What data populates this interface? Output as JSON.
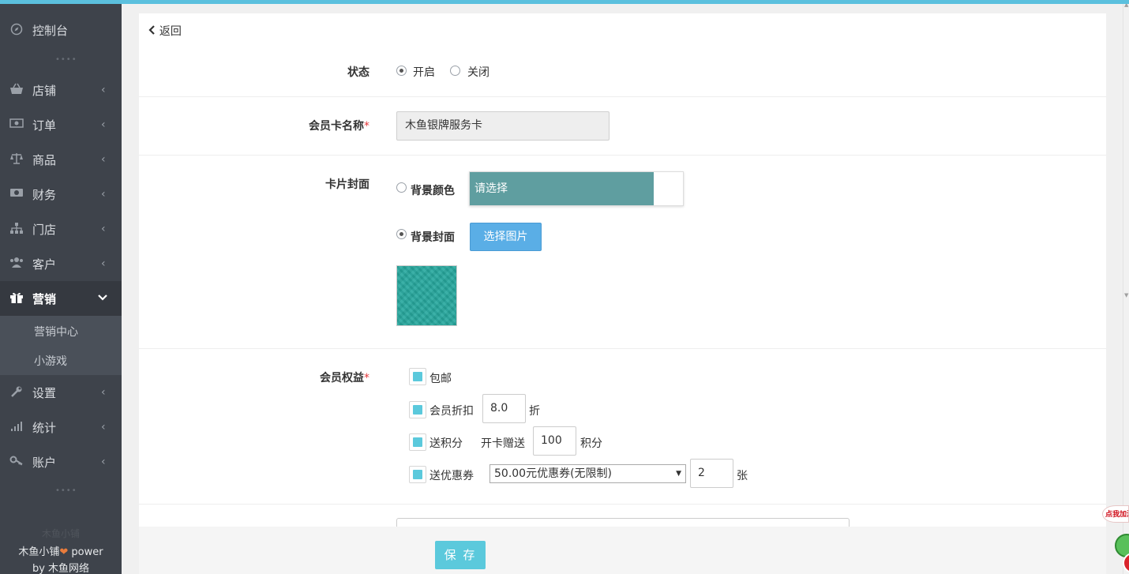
{
  "sidebar": {
    "dashboard": {
      "label": "控制台",
      "icon": "compass-icon"
    },
    "items": [
      {
        "label": "店铺",
        "icon": "basket-icon"
      },
      {
        "label": "订单",
        "icon": "money-icon"
      },
      {
        "label": "商品",
        "icon": "scale-icon"
      },
      {
        "label": "财务",
        "icon": "cash-icon"
      },
      {
        "label": "门店",
        "icon": "sitemap-icon"
      },
      {
        "label": "客户",
        "icon": "users-icon"
      },
      {
        "label": "营销",
        "icon": "gift-icon",
        "active": true
      },
      {
        "label": "设置",
        "icon": "wrench-icon"
      },
      {
        "label": "统计",
        "icon": "signal-icon"
      },
      {
        "label": "账户",
        "icon": "key-icon"
      }
    ],
    "submenu": [
      "营销中心",
      "小游戏"
    ],
    "footer_ghost": "木鱼小铺",
    "footer_line1": "木鱼小铺",
    "footer_line1_suffix": " power",
    "footer_line2": "by 木鱼网络"
  },
  "form": {
    "back_label": "返回",
    "status": {
      "label": "状态",
      "options": [
        "开启",
        "关闭"
      ],
      "selected": "开启"
    },
    "card_name": {
      "label": "会员卡名称",
      "required": "*",
      "value": "木鱼银牌服务卡"
    },
    "cover": {
      "label": "卡片封面",
      "bg_color_label": "背景颜色",
      "color_placeholder": "请选择",
      "bg_image_label": "背景封面",
      "choose_image_button": "选择图片",
      "selected": "背景封面"
    },
    "benefits": {
      "label": "会员权益",
      "required": "*",
      "free_shipping": "包邮",
      "discount_label": "会员折扣",
      "discount_value": "8.0",
      "discount_unit": "折",
      "points_label": "送积分",
      "points_prefix": "开卡赠送",
      "points_value": "100",
      "points_unit": "积分",
      "coupon_label": "送优惠券",
      "coupon_selected": "50.00元优惠券(无限制)",
      "coupon_count": "2",
      "coupon_unit": "张"
    },
    "save_button": "保 存"
  },
  "floating": {
    "badge": "点我加波"
  },
  "colors": {
    "accent": "#5bc9dc",
    "sidebar_bg": "#3e434b",
    "swatch": "#5f9ea0",
    "primary_button": "#5aaee6"
  }
}
